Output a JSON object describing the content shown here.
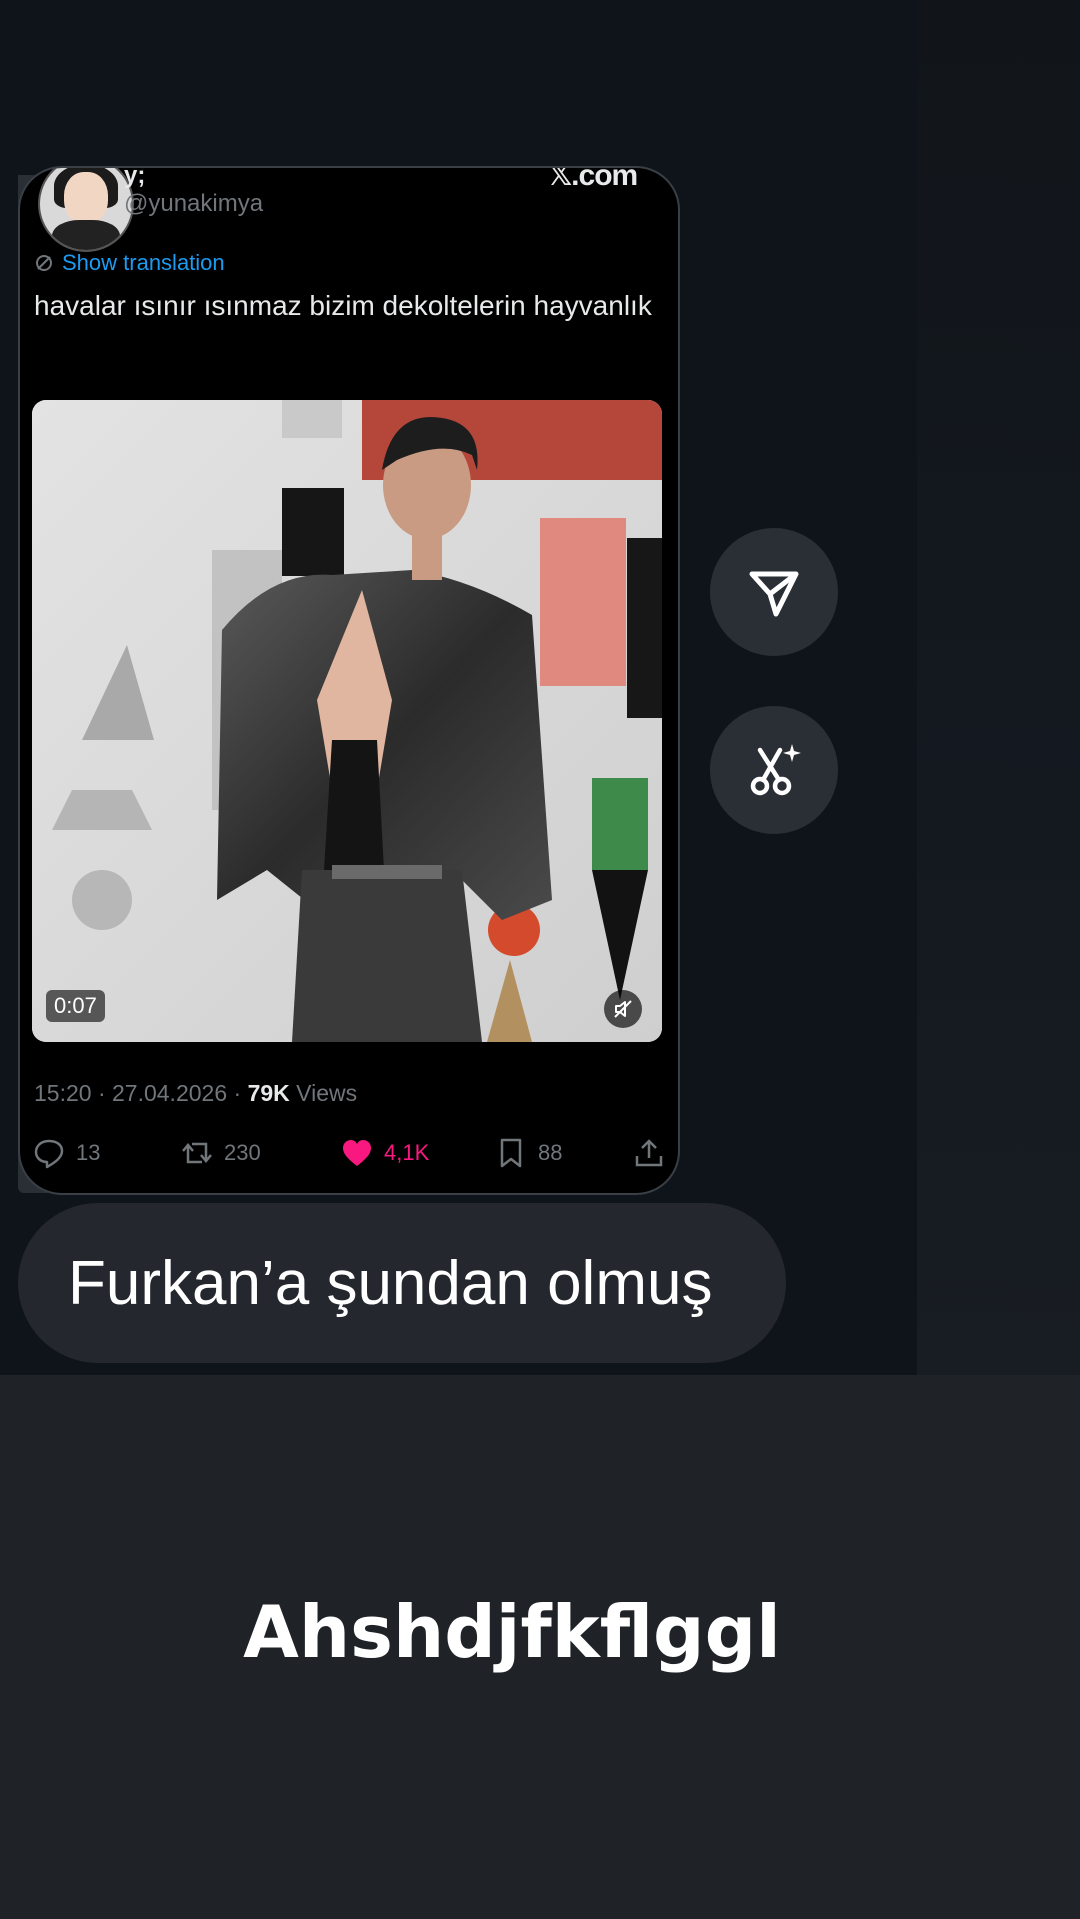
{
  "tweet": {
    "display_name": "y;",
    "handle": "@yunakimya",
    "x_logo": "𝕏.com",
    "show_translation": "Show translation",
    "text": "havalar ısınır ısınmaz bizim dekoltelerin hayvanlık",
    "video_duration": "0:07",
    "timestamp": "15:20 · 27.04.2026 · ",
    "views_count": "79K",
    "views_label": " Views",
    "replies": "13",
    "retweets": "230",
    "likes": "4,1K",
    "bookmarks": "88"
  },
  "actions": {
    "share_icon": "send-icon",
    "clip_icon": "ai-scissors-icon"
  },
  "message": {
    "text": "Furkan’a şundan olmuş"
  },
  "caption": {
    "text": "Ahshdjfkflggl"
  },
  "colors": {
    "accent_blue": "#1d9bf0",
    "like_pink": "#f91880",
    "bubble": "#24282e",
    "background": "#1f2328"
  }
}
